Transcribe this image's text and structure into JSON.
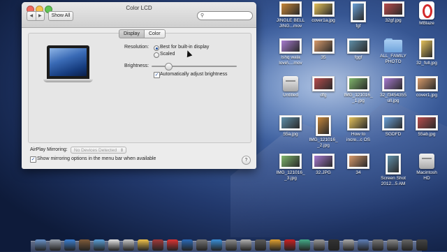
{
  "window": {
    "title": "Color LCD",
    "show_all": "Show All",
    "nav_back": "◀",
    "nav_forward": "▶",
    "search_placeholder": "",
    "search_icon": "magnifying-glass"
  },
  "tabs": [
    {
      "label": "Display",
      "selected": true
    },
    {
      "label": "Color",
      "selected": false
    }
  ],
  "display": {
    "resolution_label": "Resolution:",
    "options": [
      {
        "label": "Best for built-in display",
        "selected": true
      },
      {
        "label": "Scaled",
        "selected": false
      }
    ],
    "brightness_label": "Brightness:",
    "brightness_level": 0.2,
    "auto_brightness_label": "Automatically adjust brightness",
    "auto_brightness_checked": true
  },
  "airplay": {
    "label": "AirPlay Mirroring:",
    "value": "No Devices Detected",
    "show_mirroring_label": "Show mirroring options in the menu bar when available",
    "show_mirroring_checked": true,
    "help": "?"
  },
  "desktop": {
    "icons": [
      {
        "label": "JINGLE BELL\nJING...mov",
        "kind": "movie"
      },
      {
        "label": "cover1a.jpg",
        "kind": "photo"
      },
      {
        "label": "fgf",
        "kind": "photo"
      },
      {
        "label": "32gf.jpg",
        "kind": "photo"
      },
      {
        "label": "MBlaze",
        "kind": "opera"
      },
      {
        "label": "Ishq wala\nlove\\....mov",
        "kind": "movie"
      },
      {
        "label": "35",
        "kind": "photo"
      },
      {
        "label": "fggf",
        "kind": "photo"
      },
      {
        "label": "ALL_FAMILY\nPHOTO",
        "kind": "folder"
      },
      {
        "label": "32_full.jpg",
        "kind": "photo"
      },
      {
        "label": "Untitled",
        "kind": "drive"
      },
      {
        "label": "dfg",
        "kind": "photo"
      },
      {
        "label": "IMG_121016_\n_1.jpg",
        "kind": "photo"
      },
      {
        "label": "32_f3454355\null.jpg",
        "kind": "photo"
      },
      {
        "label": "cover1.jpg",
        "kind": "photo"
      },
      {
        "label": "55a.jpg",
        "kind": "photo"
      },
      {
        "label": "IMG_121016_\n_2.jpg",
        "kind": "photo"
      },
      {
        "label": "How to\nincre...c OS",
        "kind": "movie"
      },
      {
        "label": "SGDFD",
        "kind": "photo"
      },
      {
        "label": "55ab.jpg",
        "kind": "photo"
      },
      {
        "label": "IMG_121016_\n_3.jpg",
        "kind": "photo"
      },
      {
        "label": "32.JPG",
        "kind": "photo"
      },
      {
        "label": "34",
        "kind": "photo"
      },
      {
        "label": "Screen Shot\n2012...5 AM",
        "kind": "photo"
      },
      {
        "label": "Macintosh\nHD",
        "kind": "drive"
      }
    ]
  }
}
